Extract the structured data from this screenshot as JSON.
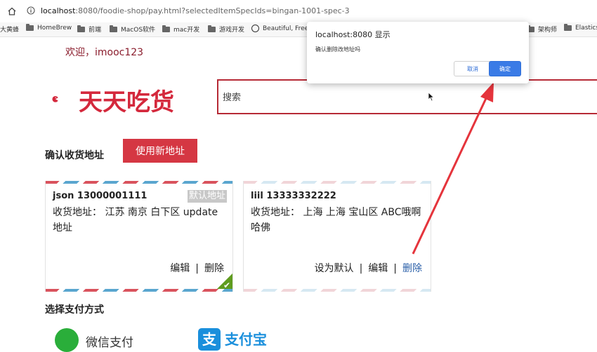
{
  "browser": {
    "url_host": "localhost",
    "url_path": ":8080/foodie-shop/pay.html?selectedItemSpecIds=bingan-1001-spec-3",
    "bookmarks": [
      {
        "label": "大黄蜂",
        "icon": "none"
      },
      {
        "label": "HomeBrew",
        "icon": "folder-icon"
      },
      {
        "label": "前端",
        "icon": "folder-icon"
      },
      {
        "label": "MacOS软件",
        "icon": "folder-icon"
      },
      {
        "label": "mac开发",
        "icon": "folder-icon"
      },
      {
        "label": "游戏开发",
        "icon": "folder-icon"
      },
      {
        "label": "Beautiful, Free",
        "icon": "github-icon"
      },
      {
        "label": "架构师",
        "icon": "folder-icon"
      },
      {
        "label": "Elastics",
        "icon": "folder-icon"
      }
    ]
  },
  "header": {
    "welcome": "欢迎，imooc123",
    "logo_text": "天天吃货",
    "search_placeholder": "搜索"
  },
  "address": {
    "title": "确认收货地址",
    "new_button": "使用新地址",
    "cards": [
      {
        "name": "json 13000001111",
        "address": "收货地址：  江苏 南京 白下区 update 地址",
        "default_badge": "默认地址",
        "edit": "编辑",
        "separator": "|",
        "delete": "删除",
        "selected": true
      },
      {
        "name": "liil 13333332222",
        "address": "收货地址：  上海 上海 宝山区 ABC哦啊哈佛",
        "set_default": "设为默认",
        "edit": "编辑",
        "separator": "|",
        "delete": "删除",
        "selected": false
      }
    ]
  },
  "payment": {
    "title": "选择支付方式",
    "options": [
      {
        "label": "微信支付",
        "icon": "wechat-icon",
        "color": "#2aae3a"
      },
      {
        "label": "支付宝",
        "icon": "alipay-icon",
        "color": "#1a8fdc"
      }
    ]
  },
  "dialog": {
    "title": "localhost:8080 显示",
    "message": "确认删除改地址吗",
    "cancel": "取消",
    "ok": "确定"
  },
  "colors": {
    "brand": "#d4283c",
    "button": "#d53743",
    "annotation_arrow": "#e5343c"
  }
}
